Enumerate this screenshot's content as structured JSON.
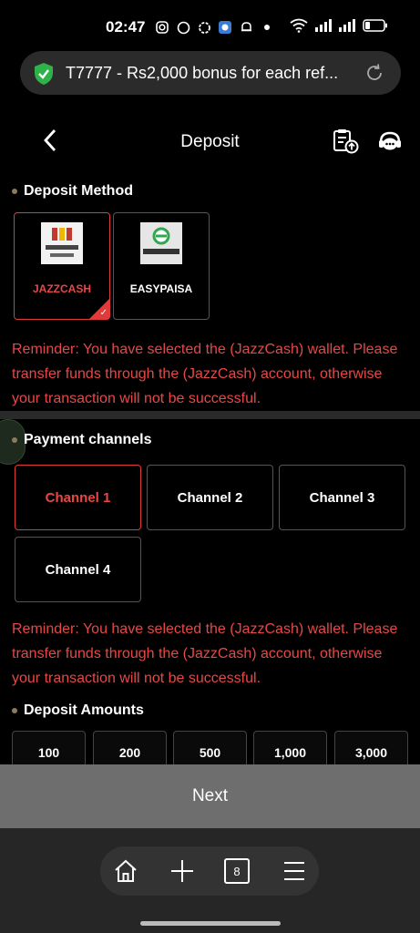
{
  "status_bar": {
    "time": "02:47",
    "icons": [
      "instagram-icon",
      "whatsapp-icon",
      "chatgpt-icon",
      "app-icon",
      "bell-icon",
      "dot-icon"
    ],
    "right_icons": [
      "wifi-icon",
      "signal-icon",
      "signal-icon",
      "battery-icon"
    ]
  },
  "browser": {
    "url_text": "T7777 - Rs2,000 bonus for each ref...",
    "tab_count": "8"
  },
  "header": {
    "title": "Deposit"
  },
  "deposit_method": {
    "label": "Deposit Method",
    "methods": [
      {
        "name": "JAZZCASH",
        "selected": true,
        "logo_text": "JazzCash"
      },
      {
        "name": "EASYPAISA",
        "selected": false,
        "logo_text": "easypaisa"
      }
    ]
  },
  "reminder_1": "Reminder: You have selected the (JazzCash) wallet. Please transfer funds through the (JazzCash) account, otherwise your transaction will not be successful.",
  "payment_channels": {
    "label": "Payment channels",
    "channels": [
      "Channel 1",
      "Channel 2",
      "Channel 3",
      "Channel 4"
    ],
    "selected_index": 0
  },
  "reminder_2": "Reminder: You have selected the (JazzCash) wallet. Please transfer funds through the (JazzCash) account, otherwise your transaction will not be successful.",
  "deposit_amounts": {
    "label": "Deposit Amounts",
    "amounts": [
      "100",
      "200",
      "500",
      "1,000",
      "3,000"
    ]
  },
  "next_label": "Next",
  "colors": {
    "accent_red": "#e03b3b",
    "reminder_red": "#e64848",
    "background": "#000000"
  }
}
